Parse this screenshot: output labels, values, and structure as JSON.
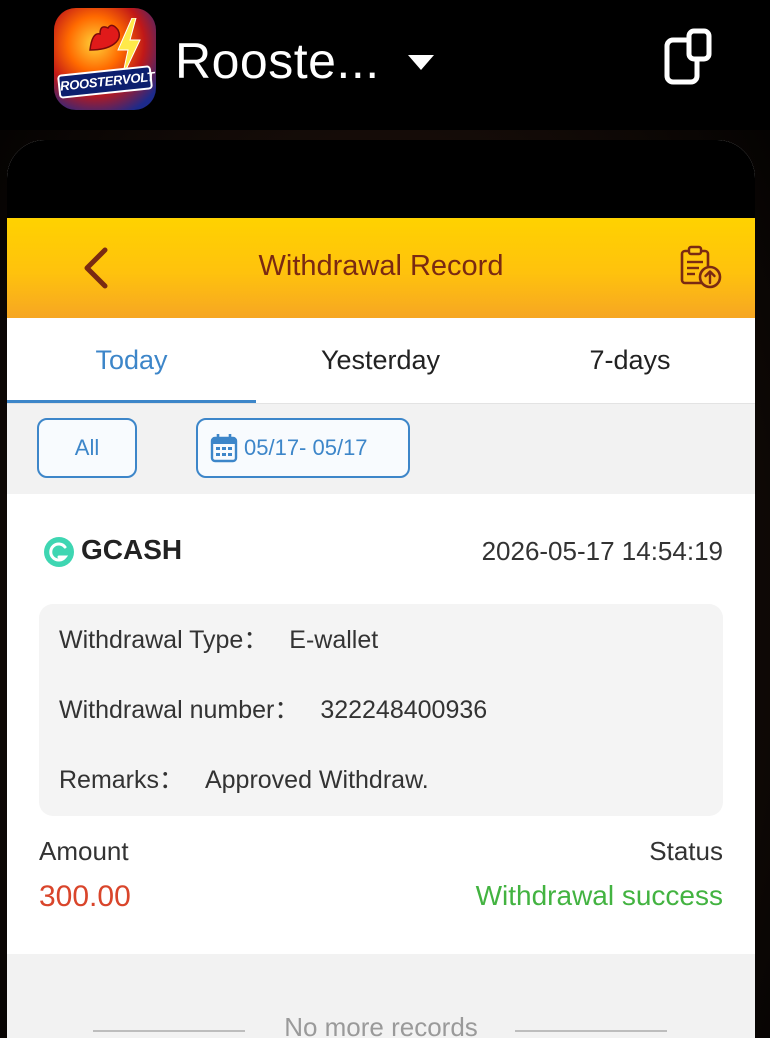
{
  "app": {
    "title": "Rooste...",
    "icon_text": "ROOSTERVOLT",
    "icons": [
      "app-logo-icon",
      "chevron-down-icon",
      "device-icon"
    ]
  },
  "header": {
    "title": "Withdrawal Record",
    "icons": [
      "back-arrow-icon",
      "clipboard-upload-icon"
    ]
  },
  "tabs": [
    {
      "label": "Today",
      "active": true
    },
    {
      "label": "Yesterday",
      "active": false
    },
    {
      "label": "7-days",
      "active": false
    }
  ],
  "filters": {
    "type_label": "All",
    "date_range": "05/17- 05/17"
  },
  "record": {
    "method": "GCASH",
    "datetime": "2026-05-17 14:54:19",
    "details": [
      {
        "label": "Withdrawal Type：",
        "value": "E-wallet"
      },
      {
        "label": "Withdrawal number：",
        "value": "322248400936"
      },
      {
        "label": "Remarks：",
        "value": "Approved Withdraw."
      }
    ],
    "amount_label": "Amount",
    "amount": "300.00",
    "status_label": "Status",
    "status": "Withdrawal success"
  },
  "footer": {
    "text": "No more records"
  },
  "colors": {
    "accent_blue": "#3d86c9",
    "header_yellow": "#ffc20d",
    "header_text": "#7a2a12",
    "amount_red": "#d9452b",
    "success_green": "#43b341"
  }
}
